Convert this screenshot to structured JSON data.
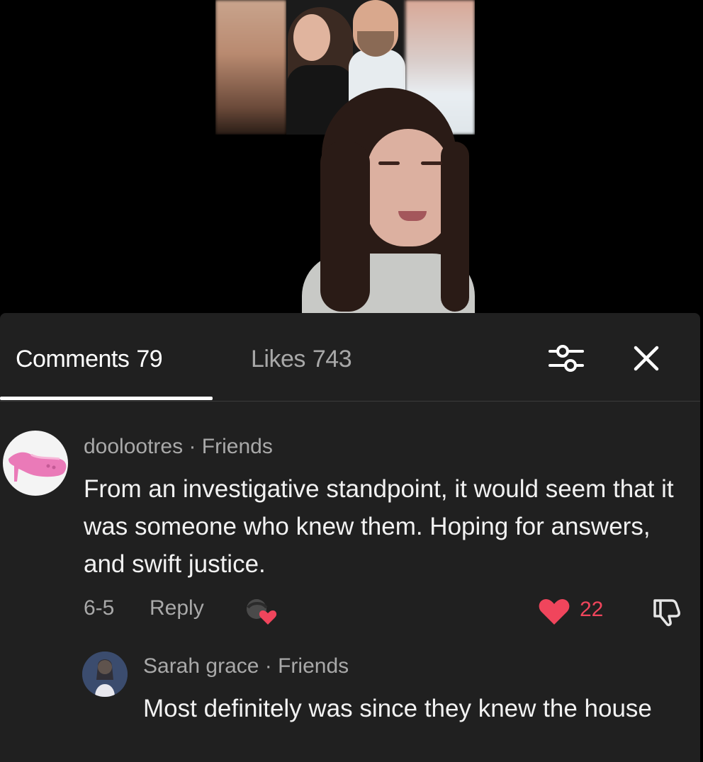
{
  "header": {
    "comments_label": "Comments",
    "comments_count": "79",
    "likes_label": "Likes",
    "likes_count": "743"
  },
  "comment": {
    "username": "doolootres",
    "relation": "· Friends",
    "text": "From an investigative standpoint, it would seem that it was someone who knew them. Hoping for answers, and swift justice.",
    "date": "6-5",
    "reply_label": "Reply",
    "like_count": "22"
  },
  "reply": {
    "username": "Sarah grace",
    "relation": "· Friends",
    "text": "Most definitely was since they knew the house"
  },
  "colors": {
    "panel": "#202020",
    "like_accent": "#f0455c",
    "muted_text": "#a9a9a9"
  }
}
